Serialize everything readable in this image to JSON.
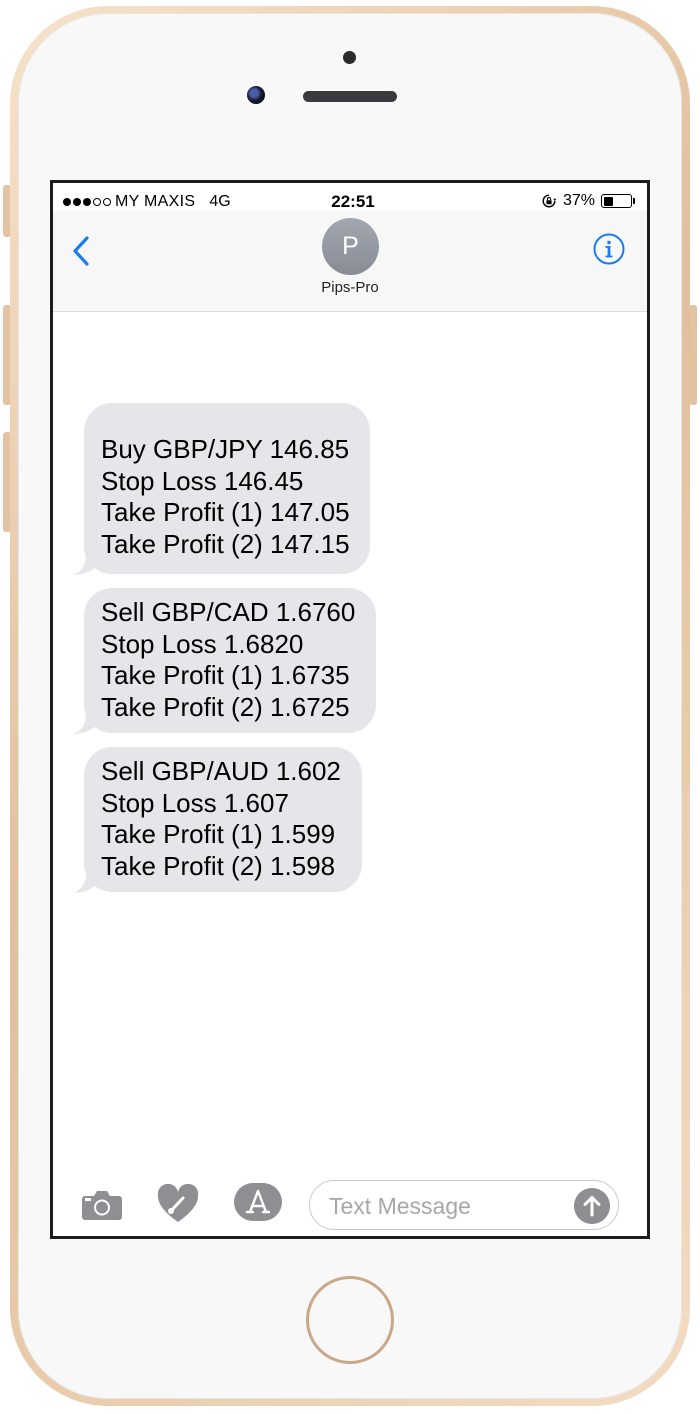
{
  "status_bar": {
    "carrier": "MY MAXIS",
    "network": "4G",
    "time": "22:51",
    "battery_text": "37%",
    "battery_level": 0.37,
    "signal_bars_filled": 3,
    "signal_bars_total": 5
  },
  "nav": {
    "avatar_initial": "P",
    "contact_name": "Pips-Pro",
    "back_icon": "chevron-left-icon",
    "info_icon": "info-icon",
    "accent_color": "#1a7cf0"
  },
  "messages": [
    {
      "lines": [
        "",
        "Buy GBP/JPY 146.85",
        "Stop Loss 146.45",
        "Take Profit (1) 147.05",
        "Take Profit (2) 147.15"
      ]
    },
    {
      "lines": [
        "Sell GBP/CAD 1.6760",
        "Stop Loss 1.6820",
        "Take Profit (1) 1.6735",
        "Take Profit (2) 1.6725"
      ]
    },
    {
      "lines": [
        "Sell GBP/AUD 1.602",
        "Stop Loss 1.607",
        "Take Profit (1) 1.599",
        "Take Profit (2) 1.598"
      ]
    }
  ],
  "composer": {
    "placeholder": "Text Message",
    "camera_icon": "camera-icon",
    "digital_touch_icon": "digital-touch-icon",
    "app_store_icon": "app-store-icon",
    "send_icon": "send-arrow-icon"
  }
}
